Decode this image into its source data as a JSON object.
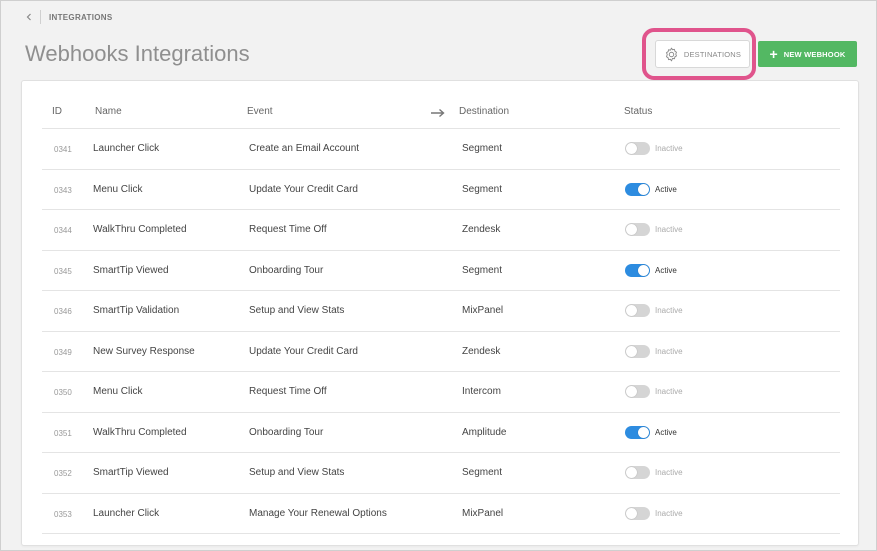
{
  "breadcrumb": {
    "label": "INTEGRATIONS"
  },
  "page": {
    "title": "Webhooks Integrations"
  },
  "toolbar": {
    "destinations_label": "DESTINATIONS",
    "new_webhook_label": "NEW WEBHOOK",
    "highlight_color": "#e0548c",
    "primary_color": "#53b863"
  },
  "table": {
    "headers": {
      "id": "ID",
      "name": "Name",
      "event": "Event",
      "destination": "Destination",
      "status": "Status"
    },
    "rows": [
      {
        "id": "0341",
        "name": "Launcher Click",
        "event": "Create an Email Account",
        "destination": "Segment",
        "status": "Inactive",
        "active": false
      },
      {
        "id": "0343",
        "name": "Menu Click",
        "event": "Update Your Credit Card",
        "destination": "Segment",
        "status": "Active",
        "active": true
      },
      {
        "id": "0344",
        "name": "WalkThru Completed",
        "event": "Request Time Off",
        "destination": "Zendesk",
        "status": "Inactive",
        "active": false
      },
      {
        "id": "0345",
        "name": "SmartTip Viewed",
        "event": "Onboarding Tour",
        "destination": "Segment",
        "status": "Active",
        "active": true
      },
      {
        "id": "0346",
        "name": "SmartTip Validation",
        "event": "Setup and View Stats",
        "destination": "MixPanel",
        "status": "Inactive",
        "active": false
      },
      {
        "id": "0349",
        "name": "New Survey Response",
        "event": "Update Your Credit Card",
        "destination": "Zendesk",
        "status": "Inactive",
        "active": false
      },
      {
        "id": "0350",
        "name": "Menu Click",
        "event": "Request Time Off",
        "destination": "Intercom",
        "status": "Inactive",
        "active": false
      },
      {
        "id": "0351",
        "name": "WalkThru Completed",
        "event": "Onboarding Tour",
        "destination": "Amplitude",
        "status": "Active",
        "active": true
      },
      {
        "id": "0352",
        "name": "SmartTip Viewed",
        "event": "Setup and View Stats",
        "destination": "Segment",
        "status": "Inactive",
        "active": false
      },
      {
        "id": "0353",
        "name": "Launcher Click",
        "event": "Manage Your Renewal Options",
        "destination": "MixPanel",
        "status": "Inactive",
        "active": false
      }
    ]
  }
}
